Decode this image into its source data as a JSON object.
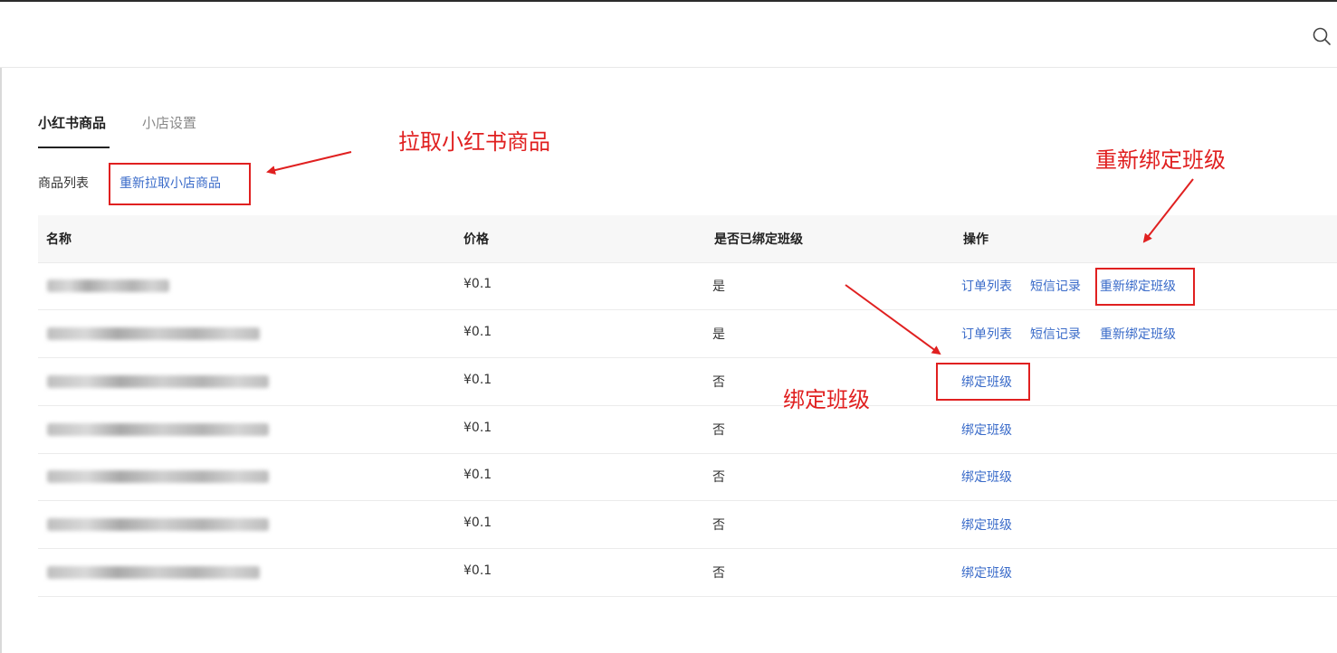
{
  "tabs": [
    {
      "label": "小红书商品",
      "active": true
    },
    {
      "label": "小店设置",
      "active": false
    }
  ],
  "toolbar": {
    "list_label": "商品列表",
    "refetch_label": "重新拉取小店商品"
  },
  "table": {
    "headers": [
      "名称",
      "价格",
      "是否已绑定班级",
      "操作"
    ],
    "rows": [
      {
        "price": "¥0.1",
        "bound": "是",
        "actions": [
          "订单列表",
          "短信记录",
          "重新绑定班级"
        ]
      },
      {
        "price": "¥0.1",
        "bound": "是",
        "actions": [
          "订单列表",
          "短信记录",
          "重新绑定班级"
        ]
      },
      {
        "price": "¥0.1",
        "bound": "否",
        "actions": [
          "绑定班级"
        ]
      },
      {
        "price": "¥0.1",
        "bound": "否",
        "actions": [
          "绑定班级"
        ]
      },
      {
        "price": "¥0.1",
        "bound": "否",
        "actions": [
          "绑定班级"
        ]
      },
      {
        "price": "¥0.1",
        "bound": "否",
        "actions": [
          "绑定班级"
        ]
      },
      {
        "price": "¥0.1",
        "bound": "否",
        "actions": [
          "绑定班级"
        ]
      }
    ]
  },
  "annotations": {
    "pull": "拉取小红书商品",
    "rebind": "重新绑定班级",
    "bind": "绑定班级"
  },
  "colors": {
    "link": "#3a6bc9",
    "annotation": "#e02020"
  },
  "icons": {
    "search": "search-icon"
  }
}
